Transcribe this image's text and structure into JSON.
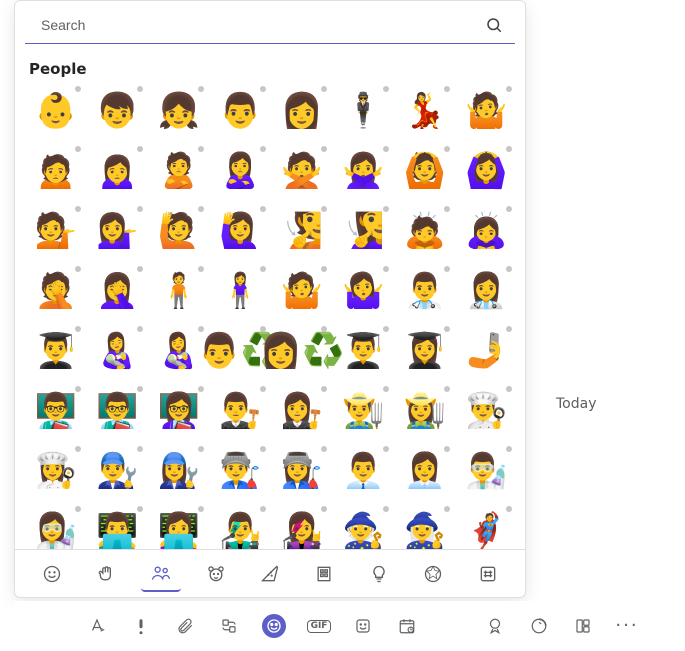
{
  "chat": {
    "today_label": "Today"
  },
  "search": {
    "placeholder": "Search",
    "value": ""
  },
  "section": {
    "title": "People"
  },
  "emojis": [
    [
      "👶",
      "👦",
      "👧",
      "👨",
      "👩",
      "🕴️",
      "💃",
      "🤷"
    ],
    [
      "🙍",
      "🙍‍♀️",
      "🙎",
      "🙎‍♀️",
      "🙅",
      "🙅‍♀️",
      "🙆",
      "🙆‍♀️"
    ],
    [
      "💁",
      "💁‍♀️",
      "🙋",
      "🙋‍♀️",
      "🧏",
      "🧏‍♀️",
      "🙇",
      "🙇‍♀️"
    ],
    [
      "🤦",
      "🤦‍♀️",
      "🧍",
      "🧍‍♀️",
      "🤷",
      "🤷‍♀️",
      "👨‍⚕️",
      "👩‍⚕️"
    ],
    [
      "👨‍🎓",
      "👩‍🍼",
      "👩‍🍼",
      "👨‍♻️",
      "👩‍♻️",
      "👨‍🎓",
      "👩‍🎓",
      "🤳"
    ],
    [
      "👨‍🏫",
      "👨‍🏫",
      "👩‍🏫",
      "👨‍⚖️",
      "👩‍⚖️",
      "👨‍🌾",
      "👩‍🌾",
      "👨‍🍳"
    ],
    [
      "👩‍🍳",
      "👨‍🔧",
      "👩‍🔧",
      "👨‍🏭",
      "👩‍🏭",
      "👨‍💼",
      "👩‍💼",
      "👨‍🔬"
    ],
    [
      "👩‍🔬",
      "👨‍💻",
      "👩‍💻",
      "👨‍🎤",
      "👩‍🎤",
      "🧙",
      "🧙‍♀️",
      "🦸"
    ]
  ],
  "categories": [
    {
      "id": "smileys",
      "name": "smileys-tab"
    },
    {
      "id": "hand",
      "name": "hand-gestures-tab"
    },
    {
      "id": "people",
      "name": "people-tab",
      "active": true
    },
    {
      "id": "animals",
      "name": "animals-tab"
    },
    {
      "id": "food",
      "name": "food-tab"
    },
    {
      "id": "travel",
      "name": "travel-tab"
    },
    {
      "id": "objects",
      "name": "objects-tab"
    },
    {
      "id": "activities",
      "name": "activities-tab"
    },
    {
      "id": "symbols",
      "name": "symbols-tab"
    }
  ],
  "compose": {
    "buttons": [
      {
        "id": "format",
        "name": "format"
      },
      {
        "id": "priority",
        "name": "priority"
      },
      {
        "id": "attach",
        "name": "attach"
      },
      {
        "id": "loop",
        "name": "loop"
      },
      {
        "id": "emoji",
        "name": "emoji",
        "active": true
      },
      {
        "id": "gif",
        "name": "gif",
        "label": "GIF"
      },
      {
        "id": "sticker",
        "name": "sticker"
      },
      {
        "id": "schedule",
        "name": "schedule"
      },
      {
        "id": "send",
        "name": "stream"
      },
      {
        "id": "approvals",
        "name": "approvals"
      },
      {
        "id": "viva",
        "name": "viva"
      },
      {
        "id": "apps",
        "name": "apps"
      },
      {
        "id": "more",
        "name": "more",
        "label": "···"
      }
    ]
  }
}
